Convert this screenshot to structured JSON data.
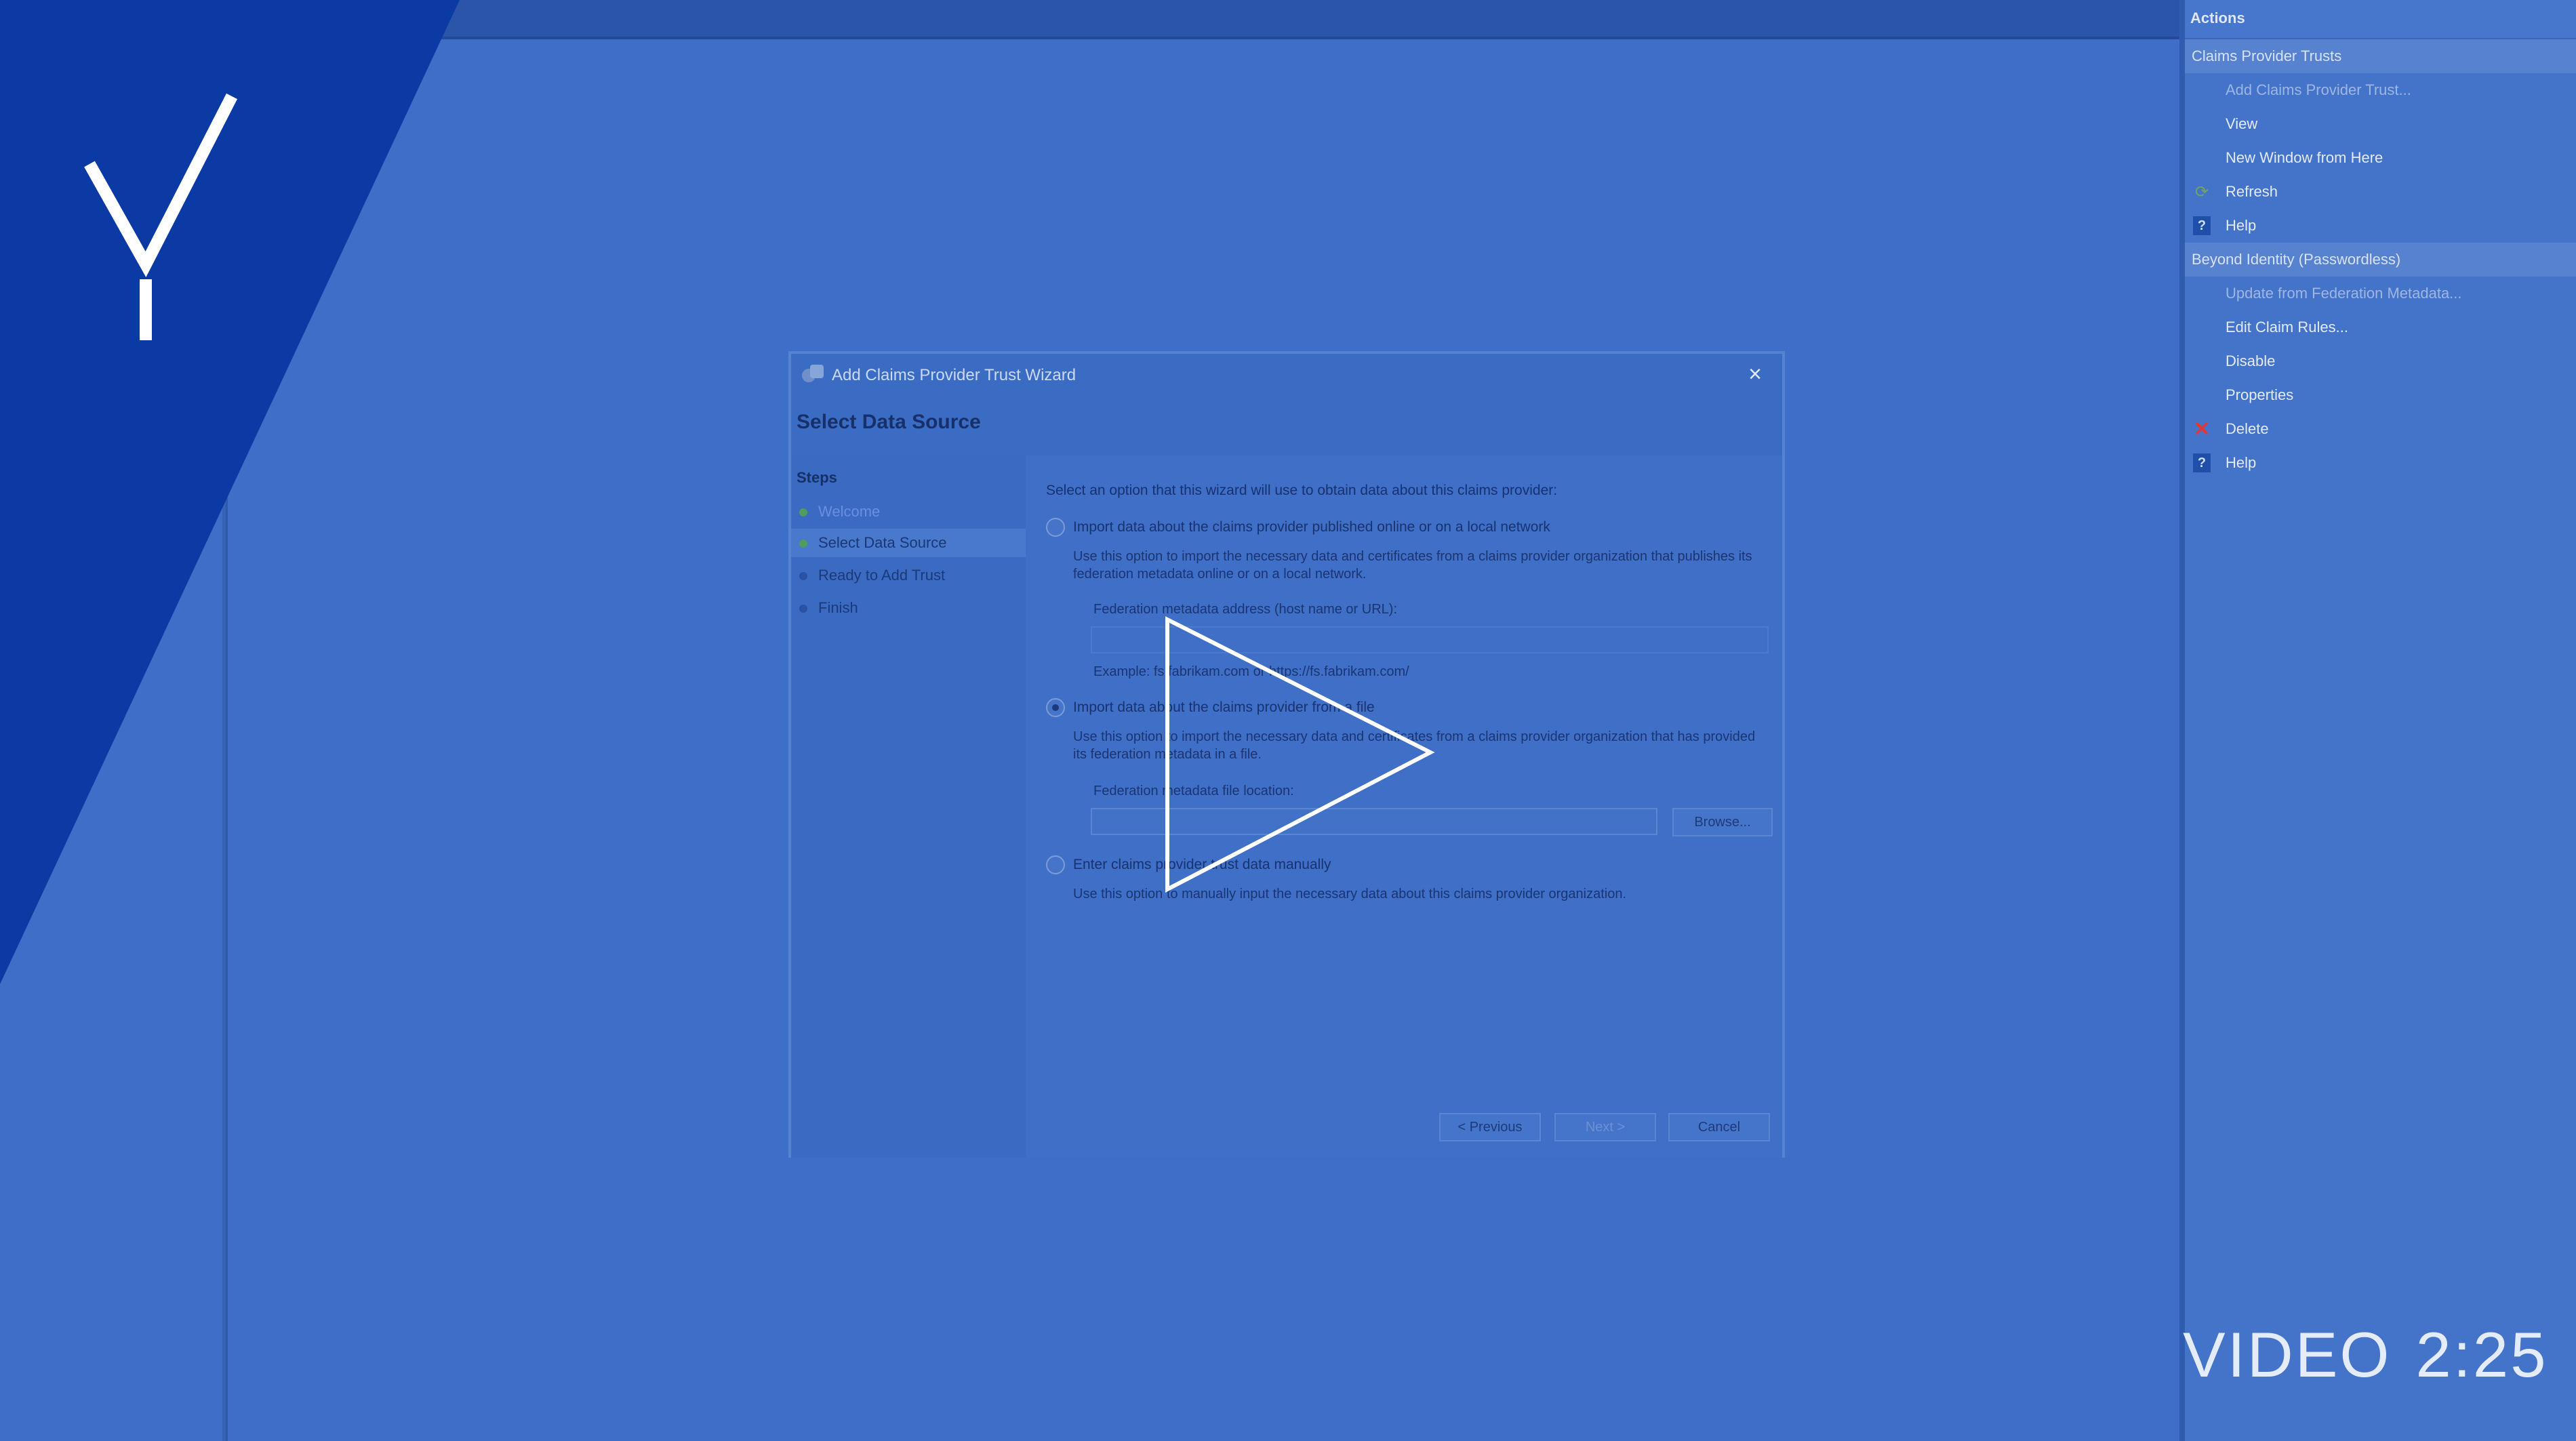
{
  "actions": {
    "header": "Actions",
    "groups": [
      {
        "title": "Claims Provider Trusts",
        "items": [
          {
            "label": "Add Claims Provider Trust...",
            "icon": "",
            "disabled": true
          },
          {
            "label": "View",
            "icon": ""
          },
          {
            "label": "New Window from Here",
            "icon": ""
          },
          {
            "label": "Refresh",
            "icon": "refresh-icon"
          },
          {
            "label": "Help",
            "icon": "help-icon"
          }
        ]
      },
      {
        "title": "Beyond Identity (Passwordless)",
        "items": [
          {
            "label": "Update from Federation Metadata...",
            "icon": "",
            "disabled": true
          },
          {
            "label": "Edit Claim Rules...",
            "icon": ""
          },
          {
            "label": "Disable",
            "icon": ""
          },
          {
            "label": "Properties",
            "icon": ""
          },
          {
            "label": "Delete",
            "icon": "delete-icon"
          },
          {
            "label": "Help",
            "icon": "help-icon"
          }
        ]
      }
    ]
  },
  "dialog": {
    "title": "Add Claims Provider Trust Wizard",
    "heading": "Select Data Source",
    "steps_title": "Steps",
    "steps": [
      {
        "label": "Welcome",
        "state": "done-link"
      },
      {
        "label": "Select Data Source",
        "state": "current"
      },
      {
        "label": "Ready to Add Trust",
        "state": "pending"
      },
      {
        "label": "Finish",
        "state": "pending"
      }
    ],
    "intro": "Select an option that this wizard will use to obtain data about this claims provider:",
    "option_online": {
      "label": "Import data about the claims provider published online or on a local network",
      "desc": "Use this option to import the necessary data and certificates from a claims provider organization that publishes its federation metadata online or on a local network.",
      "field_label": "Federation metadata address (host name or URL):",
      "example": "Example: fs.fabrikam.com or https://fs.fabrikam.com/",
      "selected": false
    },
    "option_file": {
      "label": "Import data about the claims provider from a file",
      "desc": "Use this option to import the necessary data and certificates from a claims provider organization that has provided its federation metadata in a file.",
      "field_label": "Federation metadata file location:",
      "field_value": "",
      "browse_label": "Browse...",
      "selected": true
    },
    "option_manual": {
      "label": "Enter claims provider trust data manually",
      "desc": "Use this option to manually input the necessary data about this claims provider organization.",
      "selected": false
    },
    "buttons": {
      "previous": "< Previous",
      "next": "Next >",
      "cancel": "Cancel"
    }
  },
  "video": {
    "label": "VIDEO",
    "duration": "2:25"
  },
  "colors": {
    "overlay_blue": "#3d6fc8",
    "brand_navy": "#0b3aa5",
    "delete_red": "#e03838"
  }
}
